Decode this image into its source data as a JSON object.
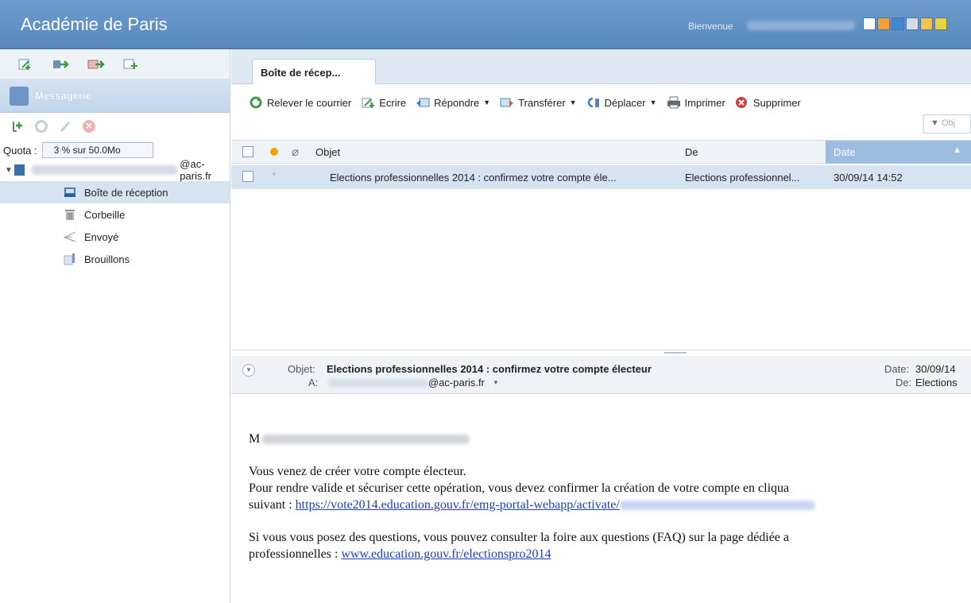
{
  "header": {
    "app_title": "Académie de Paris",
    "welcome": "Bienvenue",
    "theme_colors": [
      "#ffffff",
      "#f2a03a",
      "#3f89d4",
      "#d5dde6",
      "#f3c24a",
      "#e8d43d"
    ]
  },
  "sidebar": {
    "messagerie_label": "Messagerie",
    "quota_label": "Quota :",
    "quota_value": "3 % sur 50.0Mo",
    "account_email_domain": "@ac-paris.fr",
    "folders": [
      {
        "label": "Boîte de réception",
        "icon": "inbox-icon"
      },
      {
        "label": "Corbeille",
        "icon": "trash-icon"
      },
      {
        "label": "Envoyé",
        "icon": "sent-icon"
      },
      {
        "label": "Brouillons",
        "icon": "drafts-icon"
      }
    ]
  },
  "main": {
    "tab_label": "Boîte de récep...",
    "toolbar": {
      "fetch": "Relever le courrier",
      "write": "Ecrire",
      "reply": "Répondre",
      "forward": "Transférer",
      "move": "Déplacer",
      "print": "Imprimer",
      "delete": "Supprimer"
    },
    "filter_placeholder": "Obj",
    "columns": {
      "subject": "Objet",
      "from": "De",
      "date": "Date"
    },
    "messages": [
      {
        "subject": "Elections professionnelles 2014 : confirmez votre compte éle...",
        "from": "Elections professionnel...",
        "date": "30/09/14 14:52"
      }
    ]
  },
  "preview": {
    "subject_label": "Objet:",
    "subject": "Elections professionnelles 2014 : confirmez votre compte électeur",
    "to_label": "A:",
    "to_domain": "@ac-paris.fr",
    "date_label": "Date:",
    "date_value": "30/09/14",
    "from_label": "De:",
    "from_value": "Elections",
    "greeting_initial": "M",
    "line1": "Vous venez de créer votre compte électeur.",
    "line2": "Pour rendre valide et sécuriser cette opération, vous devez confirmer la création de votre compte en cliqua",
    "line3_prefix": "suivant : ",
    "activation_link": "https://vote2014.education.gouv.fr/emg-portal-webapp/activate/",
    "line4": "Si vous vous posez des questions, vous pouvez consulter la foire aux questions (FAQ) sur la page dédiée a",
    "line5_prefix": "professionnelles : ",
    "faq_link": "www.education.gouv.fr/electionspro2014"
  }
}
